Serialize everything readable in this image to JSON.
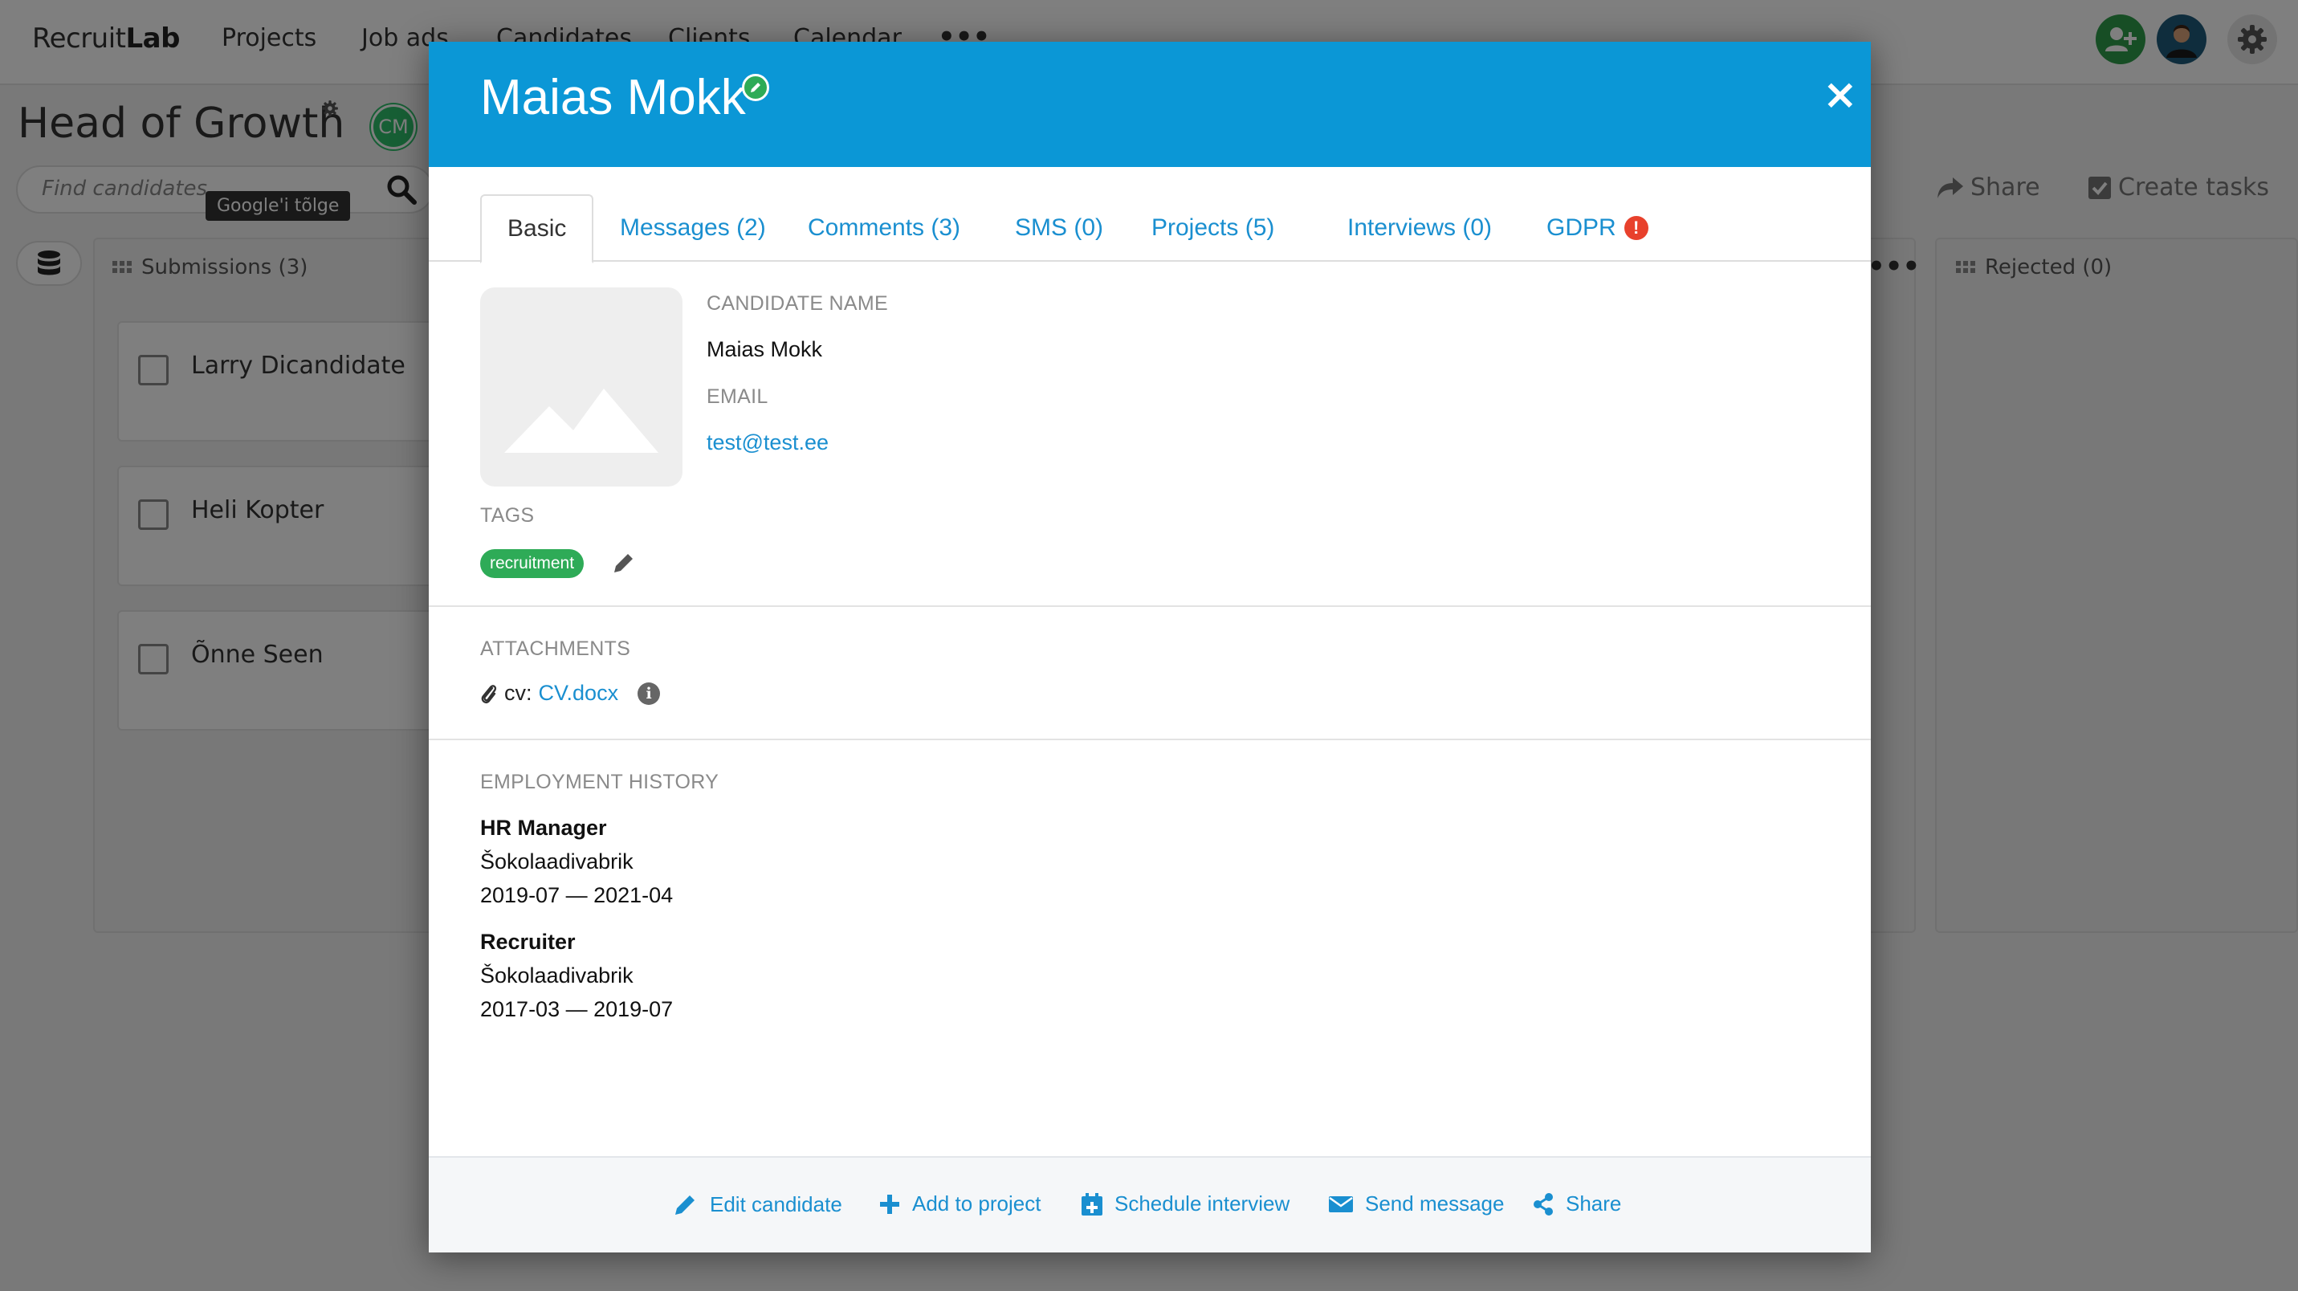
{
  "app": {
    "logo_a": "Recruit",
    "logo_b": "Lab",
    "nav": [
      "Projects",
      "Job ads",
      "Candidates",
      "Clients",
      "Calendar"
    ],
    "nav_more": "•••"
  },
  "project": {
    "title": "Head of Growth",
    "owner_initials": "CM",
    "search_placeholder": "Find candidates",
    "tooltip": "Google'i tõlge",
    "share_label": "Share",
    "create_tasks_label": "Create tasks"
  },
  "columns": {
    "submissions": "Submissions (3)",
    "rejected": "Rejected (0)",
    "more": "•••"
  },
  "candidates": [
    "Larry Dicandidate",
    "Heli Kopter",
    "Õnne Seen"
  ],
  "modal": {
    "name": "Maias Mokk",
    "close": "×",
    "tabs": [
      "Basic",
      "Messages (2)",
      "Comments (3)",
      "SMS (0)",
      "Projects (5)",
      "Interviews (0)",
      "GDPR"
    ],
    "gdpr_alert": "!",
    "candidate_name_label": "Candidate name",
    "candidate_name": "Maias Mokk",
    "email_label": "Email",
    "email": "test@test.ee",
    "tags_label": "Tags",
    "tags": [
      "recruitment"
    ],
    "attachments_label": "Attachments",
    "attachment_prefix": "cv:",
    "attachment_file": "CV.docx",
    "info": "i",
    "employment_label": "Employment history",
    "jobs": [
      {
        "title": "HR Manager",
        "company": "Šokolaadivabrik",
        "period": "2019-07 — 2021-04"
      },
      {
        "title": "Recruiter",
        "company": "Šokolaadivabrik",
        "period": "2017-03 — 2019-07"
      }
    ],
    "footer": {
      "edit": "Edit candidate",
      "add_project": "Add to project",
      "schedule": "Schedule interview",
      "send": "Send message",
      "share": "Share"
    }
  },
  "colors": {
    "header_blue": "#0b97d6",
    "link_blue": "#1a8fd0",
    "tag_green": "#2eab57",
    "alert_red": "#e8412c"
  }
}
